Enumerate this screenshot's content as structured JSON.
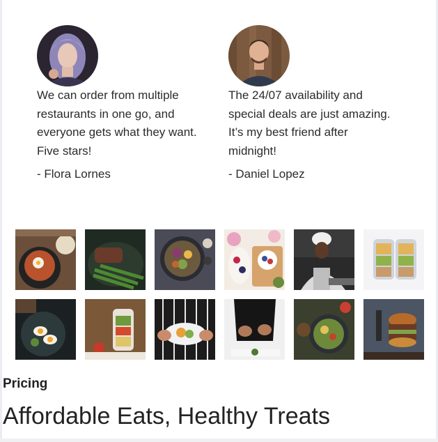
{
  "testimonials": [
    {
      "quote": "We can order from multiple restaurants in one go, and everyone gets what they want. Five stars!",
      "author": "- Flora Lornes"
    },
    {
      "quote": "The 24/07 availability and special deals are just amazing. It’s my best friend after midnight!",
      "author": "- Daniel Lopez"
    }
  ],
  "pricing": {
    "label": "Pricing",
    "headline": "Affordable Eats, Healthy Treats"
  },
  "colors": {
    "text": "#222222",
    "background": "#ffffff"
  }
}
